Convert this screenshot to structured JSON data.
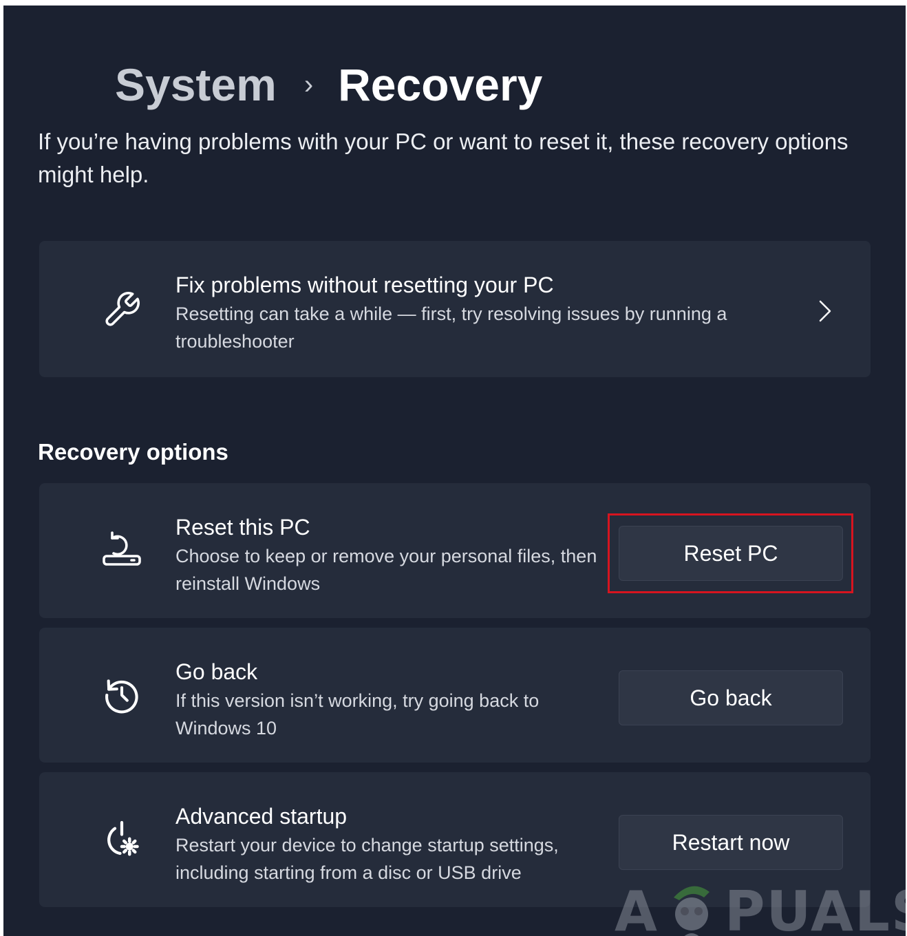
{
  "header": {
    "breadcrumb_parent": "System",
    "breadcrumb_separator": "›",
    "breadcrumb_current": "Recovery"
  },
  "intro_text": "If you’re having problems with your PC or want to reset it, these recovery options might help.",
  "fix_problems": {
    "title": "Fix problems without resetting your PC",
    "description": "Resetting can take a while — first, try resolving issues by running a troubleshooter",
    "icon": "wrench-icon",
    "chevron_icon": "chevron-right-icon"
  },
  "recovery_options": {
    "heading": "Recovery options",
    "items": [
      {
        "title": "Reset this PC",
        "description": "Choose to keep or remove your personal files, then reinstall Windows",
        "button_label": "Reset PC",
        "icon": "reset-pc-icon",
        "highlighted": true
      },
      {
        "title": "Go back",
        "description": "If this version isn’t working, try going back to Windows 10",
        "button_label": "Go back",
        "icon": "history-icon"
      },
      {
        "title": "Advanced startup",
        "description": "Restart your device to change startup settings, including starting from a disc or USB drive",
        "button_label": "Restart now",
        "icon": "advanced-startup-icon"
      }
    ]
  },
  "watermark": {
    "left_text": "A",
    "right_text": "PUALS"
  },
  "colors": {
    "background": "#1b2130",
    "card": "#252c3b",
    "button": "#2f3645",
    "highlight": "#d7141f"
  }
}
